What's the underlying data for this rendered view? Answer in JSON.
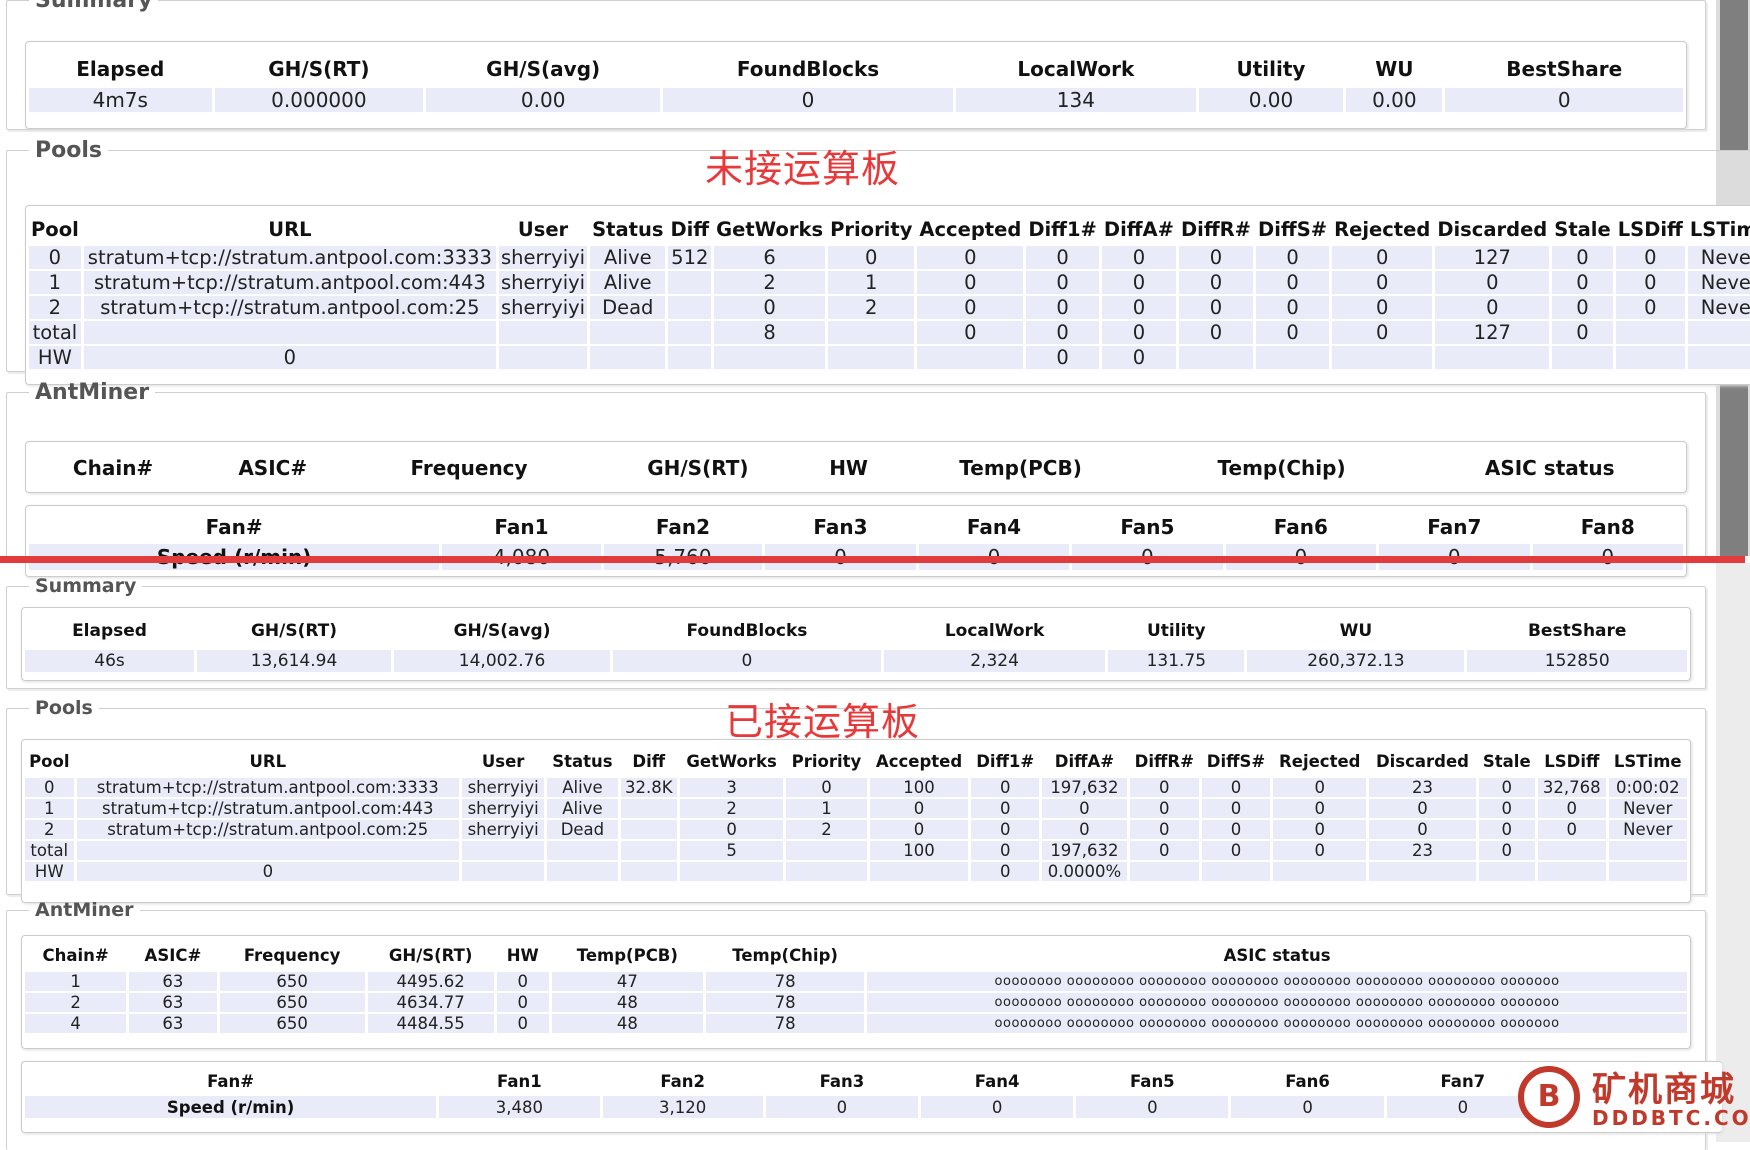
{
  "top": {
    "note": "未接运算板",
    "summary": {
      "legend": "Summary",
      "headers": [
        "Elapsed",
        "GH/S(RT)",
        "GH/S(avg)",
        "FoundBlocks",
        "LocalWork",
        "Utility",
        "WU",
        "BestShare"
      ],
      "row": [
        "4m7s",
        "0.000000",
        "0.00",
        "0",
        "134",
        "0.00",
        "0.00",
        "0"
      ]
    },
    "pools": {
      "legend": "Pools",
      "headers": [
        "Pool",
        "URL",
        "User",
        "Status",
        "Diff",
        "GetWorks",
        "Priority",
        "Accepted",
        "Diff1#",
        "DiffA#",
        "DiffR#",
        "DiffS#",
        "Rejected",
        "Discarded",
        "Stale",
        "LSDiff",
        "LSTime"
      ],
      "rows": [
        [
          "0",
          "stratum+tcp://stratum.antpool.com:3333",
          "sherryiyi",
          "Alive",
          "512",
          "6",
          "0",
          "0",
          "0",
          "0",
          "0",
          "0",
          "0",
          "127",
          "0",
          "0",
          "Never"
        ],
        [
          "1",
          "stratum+tcp://stratum.antpool.com:443",
          "sherryiyi",
          "Alive",
          "",
          "2",
          "1",
          "0",
          "0",
          "0",
          "0",
          "0",
          "0",
          "0",
          "0",
          "0",
          "Never"
        ],
        [
          "2",
          "stratum+tcp://stratum.antpool.com:25",
          "sherryiyi",
          "Dead",
          "",
          "0",
          "2",
          "0",
          "0",
          "0",
          "0",
          "0",
          "0",
          "0",
          "0",
          "0",
          "Never"
        ],
        [
          "total",
          "",
          "",
          "",
          "",
          "8",
          "",
          "0",
          "0",
          "0",
          "0",
          "0",
          "0",
          "127",
          "0",
          "",
          ""
        ],
        [
          "HW",
          "0",
          "",
          "",
          "",
          "",
          "",
          "",
          "0",
          "0",
          "",
          "",
          "",
          "",
          "",
          "",
          ""
        ]
      ]
    },
    "antminer": {
      "legend": "AntMiner",
      "chain_headers": [
        "Chain#",
        "ASIC#",
        "Frequency",
        "GH/S(RT)",
        "HW",
        "Temp(PCB)",
        "Temp(Chip)",
        "ASIC status"
      ],
      "fan_headers": [
        "Fan#",
        "Fan1",
        "Fan2",
        "Fan3",
        "Fan4",
        "Fan5",
        "Fan6",
        "Fan7",
        "Fan8"
      ],
      "fan_row": [
        "Speed (r/min)",
        "4,080",
        "5,760",
        "0",
        "0",
        "0",
        "0",
        "0",
        "0"
      ]
    }
  },
  "bottom": {
    "note": "已接运算板",
    "summary": {
      "legend": "Summary",
      "headers": [
        "Elapsed",
        "GH/S(RT)",
        "GH/S(avg)",
        "FoundBlocks",
        "LocalWork",
        "Utility",
        "WU",
        "BestShare"
      ],
      "row": [
        "46s",
        "13,614.94",
        "14,002.76",
        "0",
        "2,324",
        "131.75",
        "260,372.13",
        "152850"
      ]
    },
    "pools": {
      "legend": "Pools",
      "headers": [
        "Pool",
        "URL",
        "User",
        "Status",
        "Diff",
        "GetWorks",
        "Priority",
        "Accepted",
        "Diff1#",
        "DiffA#",
        "DiffR#",
        "DiffS#",
        "Rejected",
        "Discarded",
        "Stale",
        "LSDiff",
        "LSTime"
      ],
      "rows": [
        [
          "0",
          "stratum+tcp://stratum.antpool.com:3333",
          "sherryiyi",
          "Alive",
          "32.8K",
          "3",
          "0",
          "100",
          "0",
          "197,632",
          "0",
          "0",
          "0",
          "23",
          "0",
          "32,768",
          "0:00:02"
        ],
        [
          "1",
          "stratum+tcp://stratum.antpool.com:443",
          "sherryiyi",
          "Alive",
          "",
          "2",
          "1",
          "0",
          "0",
          "0",
          "0",
          "0",
          "0",
          "0",
          "0",
          "0",
          "Never"
        ],
        [
          "2",
          "stratum+tcp://stratum.antpool.com:25",
          "sherryiyi",
          "Dead",
          "",
          "0",
          "2",
          "0",
          "0",
          "0",
          "0",
          "0",
          "0",
          "0",
          "0",
          "0",
          "Never"
        ],
        [
          "total",
          "",
          "",
          "",
          "",
          "5",
          "",
          "100",
          "0",
          "197,632",
          "0",
          "0",
          "0",
          "23",
          "0",
          "",
          ""
        ],
        [
          "HW",
          "0",
          "",
          "",
          "",
          "",
          "",
          "",
          "0",
          "0.0000%",
          "",
          "",
          "",
          "",
          "",
          "",
          ""
        ]
      ]
    },
    "antminer": {
      "legend": "AntMiner",
      "chain_headers": [
        "Chain#",
        "ASIC#",
        "Frequency",
        "GH/S(RT)",
        "HW",
        "Temp(PCB)",
        "Temp(Chip)",
        "ASIC status"
      ],
      "chain_rows": [
        [
          "1",
          "63",
          "650",
          "4495.62",
          "0",
          "47",
          "78",
          "oooooooo oooooooo oooooooo oooooooo oooooooo oooooooo oooooooo ooooooo"
        ],
        [
          "2",
          "63",
          "650",
          "4634.77",
          "0",
          "48",
          "78",
          "oooooooo oooooooo oooooooo oooooooo oooooooo oooooooo oooooooo ooooooo"
        ],
        [
          "4",
          "63",
          "650",
          "4484.55",
          "0",
          "48",
          "78",
          "oooooooo oooooooo oooooooo oooooooo oooooooo oooooooo oooooooo ooooooo"
        ]
      ],
      "fan_headers": [
        "Fan#",
        "Fan1",
        "Fan2",
        "Fan3",
        "Fan4",
        "Fan5",
        "Fan6",
        "Fan7"
      ],
      "fan_row": [
        "Speed (r/min)",
        "3,480",
        "3,120",
        "0",
        "0",
        "0",
        "0",
        "0"
      ]
    }
  },
  "watermark": {
    "logo_glyph": "B",
    "title": "矿机商城",
    "domain": "DDDBTC.COM"
  }
}
